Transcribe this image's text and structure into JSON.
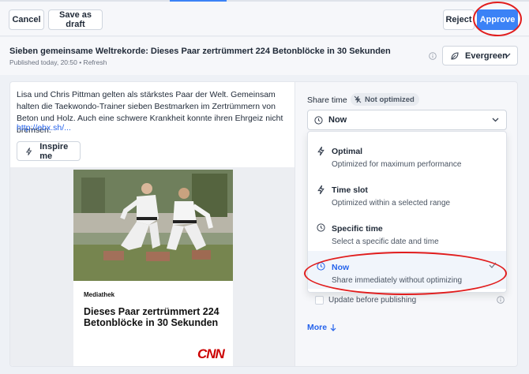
{
  "toolbar": {
    "cancel_label": "Cancel",
    "save_draft_label": "Save as draft",
    "reject_label": "Reject",
    "approve_label": "Approve"
  },
  "header": {
    "title": "Sieben gemeinsame Weltrekorde: Dieses Paar zertrümmert 224 Betonblöcke in 30 Sekunden",
    "meta": "Published today, 20:50 • Refresh",
    "evergreen_label": "Evergreen"
  },
  "post": {
    "text": "Lisa und Chris Pittman gelten als stärkstes Paar der Welt. Gemeinsam halten die Taekwondo-Trainer sieben Bestmarken im Zertrümmern von Beton und Holz. Auch eine schwere Krankheit konnte ihren Ehrgeiz nicht bremsen.",
    "link": "http://ebx.sh/...",
    "inspire_label": "Inspire me"
  },
  "preview_card": {
    "source": "Mediathek",
    "headline": "Dieses Paar zertrümmert 224 Betonblöcke in 30 Sekunden",
    "logo_text": "CNN",
    "logo_color": "#cc0000"
  },
  "share": {
    "label": "Share time",
    "badge": "Not optimized",
    "selected": "Now",
    "options": [
      {
        "title": "Optimal",
        "subtitle": "Optimized for maximum performance",
        "icon": "bolt-icon"
      },
      {
        "title": "Time slot",
        "subtitle": "Optimized within a selected range",
        "icon": "bolt-icon"
      },
      {
        "title": "Specific time",
        "subtitle": "Select a specific date and time",
        "icon": "clock-icon"
      },
      {
        "title": "Now",
        "subtitle": "Share immediately without optimizing",
        "icon": "clock-icon",
        "selected": true
      }
    ],
    "update_label": "Update before publishing",
    "more_label": "More"
  },
  "colors": {
    "accent": "#3b82f6",
    "annotation": "#e11d1d"
  }
}
